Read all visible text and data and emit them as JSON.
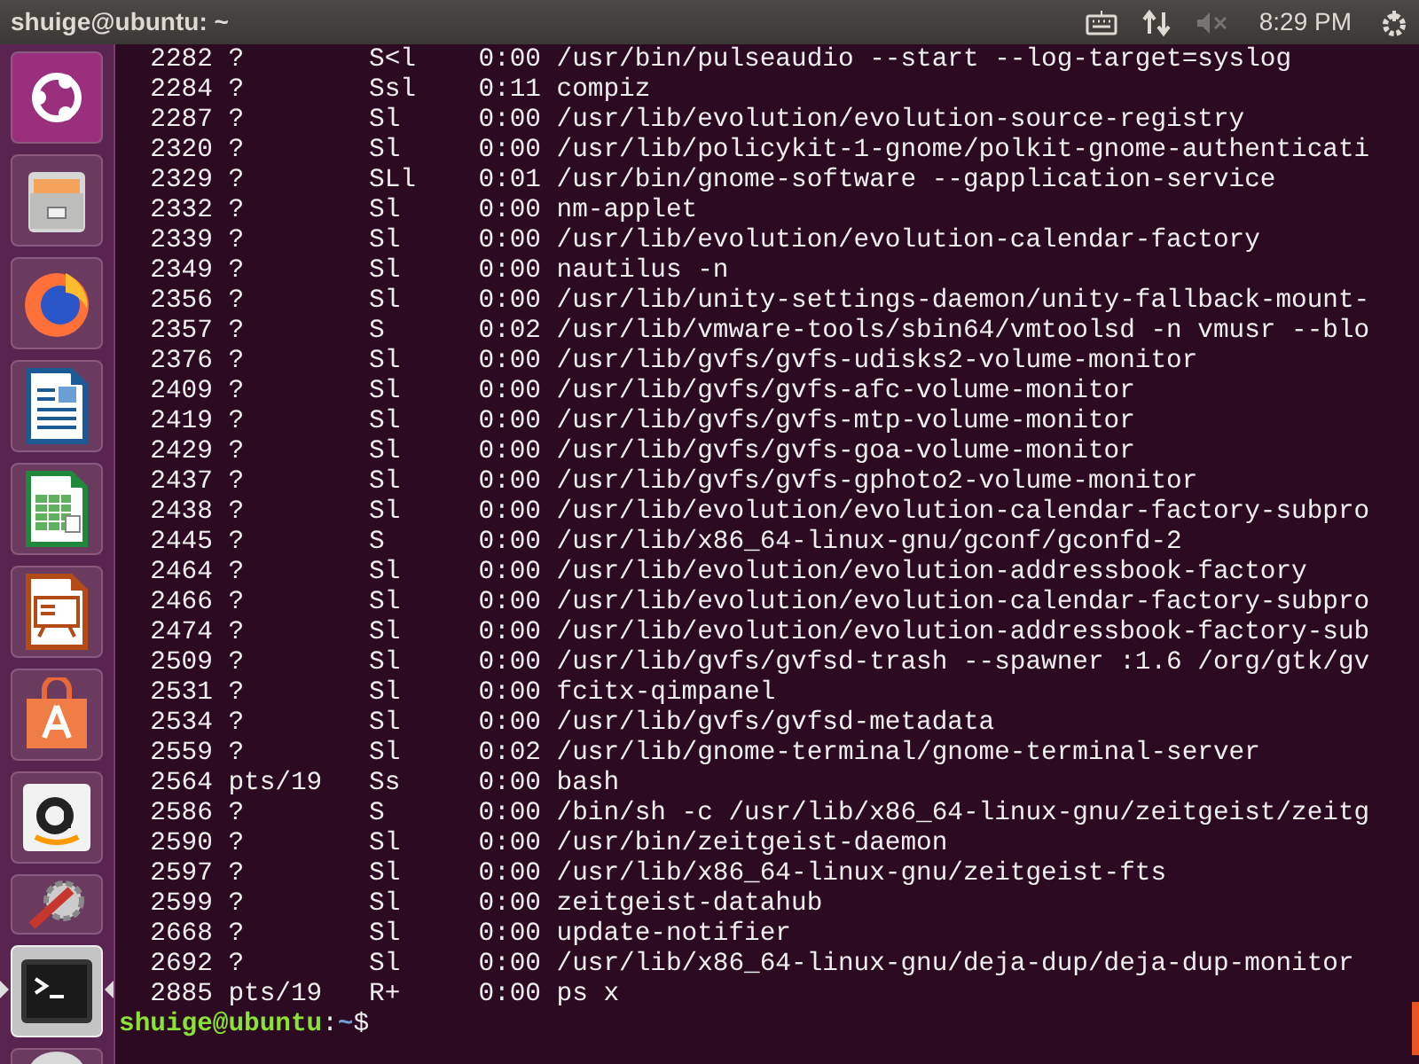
{
  "top_bar": {
    "title": "shuige@ubuntu: ~",
    "time": "8:29 PM",
    "volume_muted": true
  },
  "launcher": [
    {
      "kind": "dash",
      "active": false
    },
    {
      "kind": "files",
      "active": false
    },
    {
      "kind": "browser",
      "active": false
    },
    {
      "kind": "writer",
      "active": false
    },
    {
      "kind": "calc",
      "active": false
    },
    {
      "kind": "impress",
      "active": false
    },
    {
      "kind": "store",
      "active": false
    },
    {
      "kind": "amazon",
      "active": false
    },
    {
      "kind": "settings",
      "active": false
    },
    {
      "kind": "terminal",
      "active": true
    },
    {
      "kind": "disc",
      "active": false
    }
  ],
  "terminal": {
    "lines": [
      "  2282 ?        S<l    0:00 /usr/bin/pulseaudio --start --log-target=syslog",
      "  2284 ?        Ssl    0:11 compiz",
      "  2287 ?        Sl     0:00 /usr/lib/evolution/evolution-source-registry",
      "  2320 ?        Sl     0:00 /usr/lib/policykit-1-gnome/polkit-gnome-authenticati",
      "  2329 ?        SLl    0:01 /usr/bin/gnome-software --gapplication-service",
      "  2332 ?        Sl     0:00 nm-applet",
      "  2339 ?        Sl     0:00 /usr/lib/evolution/evolution-calendar-factory",
      "  2349 ?        Sl     0:00 nautilus -n",
      "  2356 ?        Sl     0:00 /usr/lib/unity-settings-daemon/unity-fallback-mount-",
      "  2357 ?        S      0:02 /usr/lib/vmware-tools/sbin64/vmtoolsd -n vmusr --blo",
      "  2376 ?        Sl     0:00 /usr/lib/gvfs/gvfs-udisks2-volume-monitor",
      "  2409 ?        Sl     0:00 /usr/lib/gvfs/gvfs-afc-volume-monitor",
      "  2419 ?        Sl     0:00 /usr/lib/gvfs/gvfs-mtp-volume-monitor",
      "  2429 ?        Sl     0:00 /usr/lib/gvfs/gvfs-goa-volume-monitor",
      "  2437 ?        Sl     0:00 /usr/lib/gvfs/gvfs-gphoto2-volume-monitor",
      "  2438 ?        Sl     0:00 /usr/lib/evolution/evolution-calendar-factory-subpro",
      "  2445 ?        S      0:00 /usr/lib/x86_64-linux-gnu/gconf/gconfd-2",
      "  2464 ?        Sl     0:00 /usr/lib/evolution/evolution-addressbook-factory",
      "  2466 ?        Sl     0:00 /usr/lib/evolution/evolution-calendar-factory-subpro",
      "  2474 ?        Sl     0:00 /usr/lib/evolution/evolution-addressbook-factory-sub",
      "  2509 ?        Sl     0:00 /usr/lib/gvfs/gvfsd-trash --spawner :1.6 /org/gtk/gv",
      "  2531 ?        Sl     0:00 fcitx-qimpanel",
      "  2534 ?        Sl     0:00 /usr/lib/gvfs/gvfsd-metadata",
      "  2559 ?        Sl     0:02 /usr/lib/gnome-terminal/gnome-terminal-server",
      "  2564 pts/19   Ss     0:00 bash",
      "  2586 ?        S      0:00 /bin/sh -c /usr/lib/x86_64-linux-gnu/zeitgeist/zeitg",
      "  2590 ?        Sl     0:00 /usr/bin/zeitgeist-daemon",
      "  2597 ?        Sl     0:00 /usr/lib/x86_64-linux-gnu/zeitgeist-fts",
      "  2599 ?        Sl     0:00 zeitgeist-datahub",
      "  2668 ?        Sl     0:00 update-notifier",
      "  2692 ?        Sl     0:00 /usr/lib/x86_64-linux-gnu/deja-dup/deja-dup-monitor",
      "  2885 pts/19   R+     0:00 ps x"
    ],
    "prompt": {
      "user_host": "shuige@ubuntu",
      "separator": ":",
      "path": "~",
      "symbol": "$"
    }
  }
}
